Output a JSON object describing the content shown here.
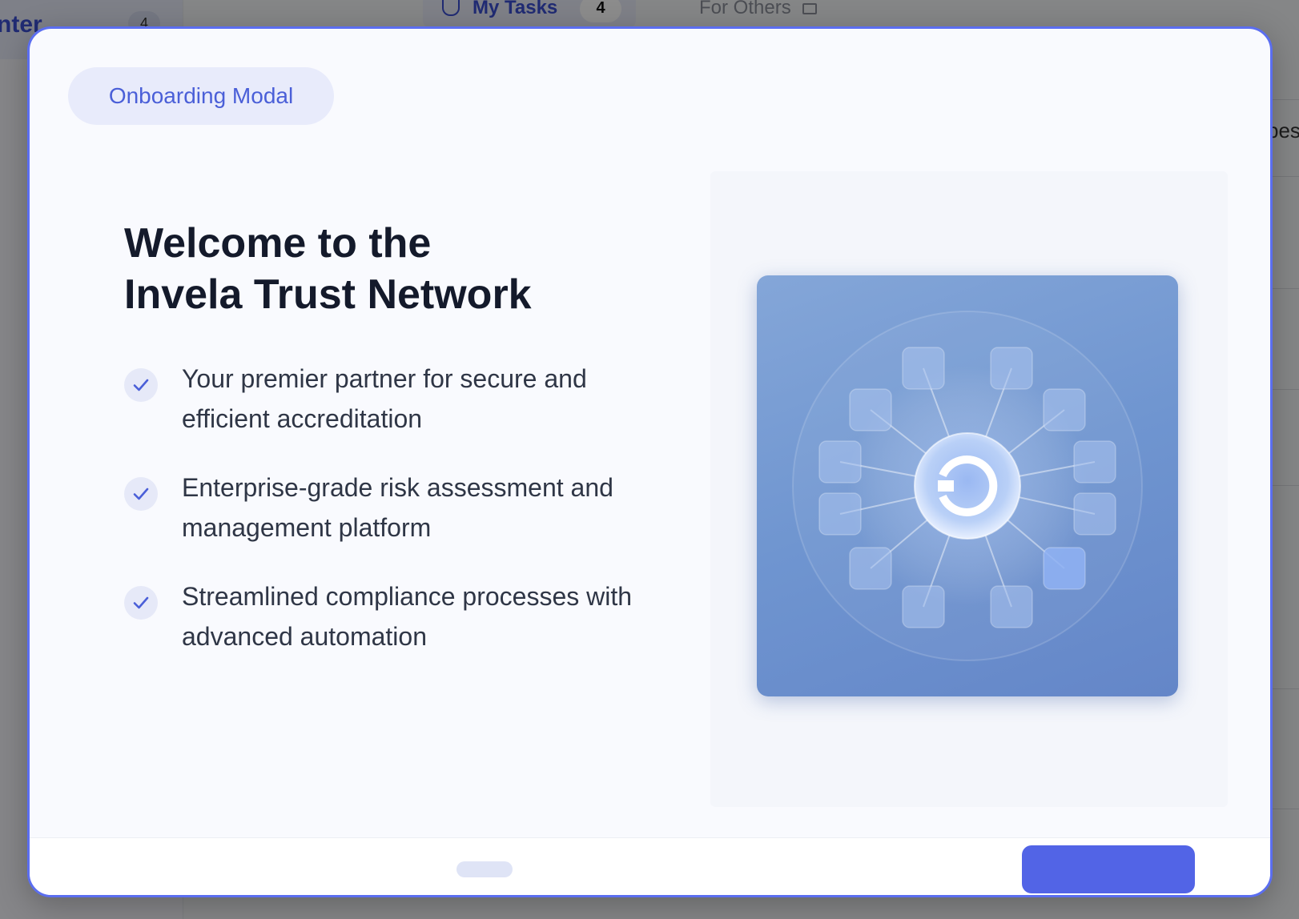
{
  "background": {
    "sidebar_label": "nter",
    "sidebar_count": "4",
    "tabs": [
      {
        "label": "My Tasks",
        "count": "4"
      },
      {
        "label": "For Others"
      }
    ],
    "right_text": "pes"
  },
  "modal": {
    "badge": "Onboarding Modal",
    "title_line1": "Welcome to the",
    "title_line2": "Invela Trust Network",
    "features": [
      "Your premier partner for secure and efficient accreditation",
      "Enterprise-grade risk assessment and management platform",
      "Streamlined compliance processes with advanced automation"
    ],
    "illustration": "network-hub-illustration"
  },
  "colors": {
    "accent": "#5264e6",
    "modal_border": "#5b6ef0",
    "title": "#141a2b",
    "illustration_bg": "#6f95d0"
  }
}
